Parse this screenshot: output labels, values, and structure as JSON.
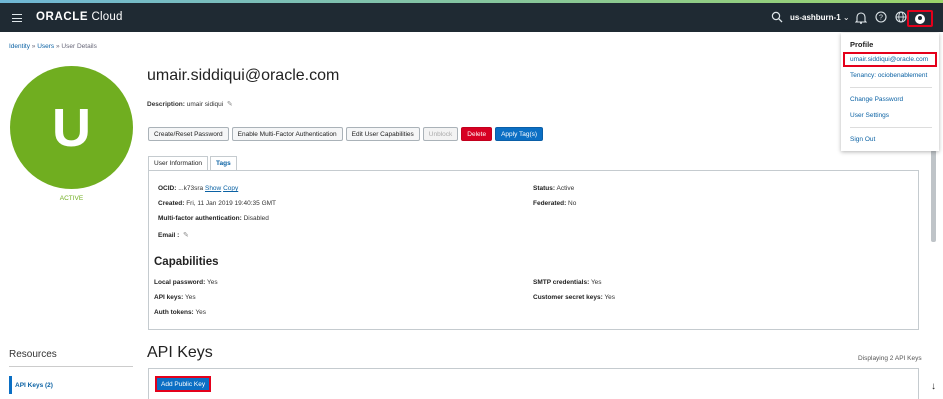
{
  "topbar": {
    "brand_bold": "ORACLE",
    "brand_light": " Cloud",
    "region": "us-ashburn-1",
    "icons": [
      "menu-icon",
      "search-icon",
      "chevron-down-icon",
      "bell-icon",
      "help-icon",
      "globe-icon",
      "profile-icon"
    ]
  },
  "breadcrumb": {
    "identity": "Identity",
    "sep1": " » ",
    "users": "Users",
    "sep2": " » ",
    "current": "User Details"
  },
  "user": {
    "initial": "U",
    "status": "ACTIVE",
    "title": "umair.siddiqui@oracle.com",
    "description_label": "Description:",
    "description_value": "umair sidiqui"
  },
  "actions": {
    "create_reset_password": "Create/Reset Password",
    "enable_mfa": "Enable Multi-Factor Authentication",
    "edit_capabilities": "Edit User Capabilities",
    "unblock": "Unblock",
    "delete": "Delete",
    "apply_tags": "Apply Tag(s)"
  },
  "tabs": {
    "user_information": "User Information",
    "tags": "Tags"
  },
  "info": {
    "ocid_label": "OCID:",
    "ocid_value": "...k73sra",
    "show": "Show",
    "copy": "Copy",
    "created_label": "Created:",
    "created_value": "Fri, 11 Jan 2019 19:40:35 GMT",
    "mfa_label": "Multi-factor authentication:",
    "mfa_value": "Disabled",
    "email_label": "Email :",
    "status_label": "Status:",
    "status_value": "Active",
    "federated_label": "Federated:",
    "federated_value": "No"
  },
  "capabilities": {
    "heading": "Capabilities",
    "local_password_label": "Local password:",
    "local_password_value": "Yes",
    "api_keys_label": "API keys:",
    "api_keys_value": "Yes",
    "auth_tokens_label": "Auth tokens:",
    "auth_tokens_value": "Yes",
    "smtp_label": "SMTP credentials:",
    "smtp_value": "Yes",
    "customer_secret_label": "Customer secret keys:",
    "customer_secret_value": "Yes"
  },
  "resources": {
    "title": "Resources",
    "api_keys_item": "API Keys (2)"
  },
  "api_keys": {
    "title": "API Keys",
    "count": "Displaying 2 API Keys",
    "add_button": "Add Public Key"
  },
  "profile_menu": {
    "title": "Profile",
    "email": "umair.siddiqui@oracle.com",
    "tenancy": "Tenancy: ociobenablement",
    "change_password": "Change Password",
    "user_settings": "User Settings",
    "sign_out": "Sign Out"
  }
}
